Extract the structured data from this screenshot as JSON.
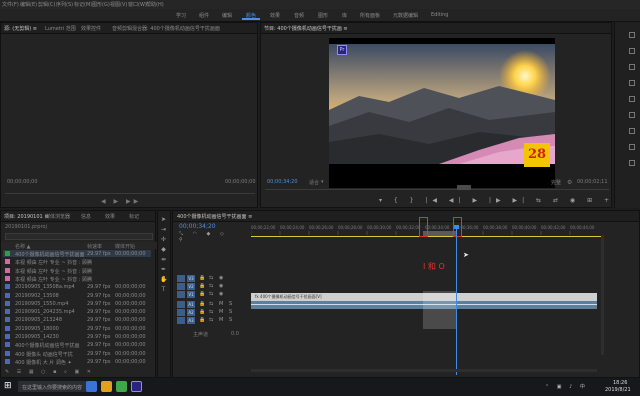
{
  "menu": [
    "文件(F)",
    "编辑(E)",
    "剪辑(C)",
    "序列(S)",
    "标记(M)",
    "图形(G)",
    "视图(V)",
    "窗口(W)",
    "帮助(H)"
  ],
  "workspaces": [
    "学习",
    "组件",
    "编辑",
    "颜色",
    "效果",
    "音频",
    "图形",
    "库",
    "所有面板",
    "元数据编辑",
    "Editing"
  ],
  "active_workspace": "颜色",
  "source_panel": {
    "tabs": [
      "源: (无剪辑) ≡",
      "Lumetri 范围",
      "效果控件",
      "音频剪辑混合器: 400个摄像机动画信号干扰画面"
    ],
    "tc_left": "00;00;00;00",
    "tc_right": "00;00;00;00"
  },
  "program_panel": {
    "title": "节目: 400个摄像机动画信号干扰画 ≡",
    "playhead_tc": "00;00;34;20",
    "fit_label": "适合",
    "quality_label": "完整",
    "duration_tc": "00;00;02;11",
    "pr_badge": "Pr",
    "overlay_number": "28"
  },
  "project_panel": {
    "tabs": [
      "项目: 20190101 ≡",
      "媒体浏览器",
      "信息",
      "效果",
      "标记"
    ],
    "project_file": "20190101.prproj",
    "columns": [
      "名称 ▲",
      "帧速率",
      "媒体开始"
    ],
    "rows": [
      {
        "name": "400个摄像机动画信号干扰画面",
        "fps": "29.97 fps",
        "start": "00;00;00;00",
        "color": "#2ea043"
      },
      {
        "name": "本视 频由 左叶 专业 ~ 抖音 : 顾腾",
        "fps": "",
        "start": "",
        "color": "#d16aa8"
      },
      {
        "name": "本视 频由 左叶 专业 ~ 抖音 : 顾腾",
        "fps": "",
        "start": "",
        "color": "#d16aa8"
      },
      {
        "name": "本视 频由 左叶 专业 ~ 抖音 : 顾腾",
        "fps": "",
        "start": "",
        "color": "#d16aa8"
      },
      {
        "name": "20190905_13508a.mp4",
        "fps": "29.97 fps",
        "start": "00;00;00;00",
        "color": "#4b69b8"
      },
      {
        "name": "20190902_13508",
        "fps": "29.97 fps",
        "start": "00;00;00;00",
        "color": "#4b69b8"
      },
      {
        "name": "20190905_1550.mp4",
        "fps": "29.97 fps",
        "start": "00;00;00;00",
        "color": "#4b69b8"
      },
      {
        "name": "20190901_204235.mp4",
        "fps": "29.97 fps",
        "start": "00;00;00;00",
        "color": "#4b69b8"
      },
      {
        "name": "20190905_213248",
        "fps": "29.97 fps",
        "start": "00;00;00;00",
        "color": "#4b69b8"
      },
      {
        "name": "20190905_18000",
        "fps": "29.97 fps",
        "start": "00;00;00;00",
        "color": "#4b69b8"
      },
      {
        "name": "20190905_14230",
        "fps": "29.97 fps",
        "start": "00;00;00;00",
        "color": "#4b69b8"
      },
      {
        "name": "400个摄像机动画信号干扰画",
        "fps": "29.97 fps",
        "start": "00;00;00;00",
        "color": "#4b69b8"
      },
      {
        "name": "400 摄像头 动画信号干扰",
        "fps": "29.97 fps",
        "start": "00;00;00;00",
        "color": "#4b69b8"
      },
      {
        "name": "400 摄像机 大 片 调色 ✦",
        "fps": "29.97 fps",
        "start": "00;00;00;00",
        "color": "#4b69b8"
      }
    ]
  },
  "timeline": {
    "title": "400个摄像机动画信号干扰画面 ≡",
    "playhead_tc": "00;00;34;20",
    "ticks": [
      "00;00;22;00",
      "00;00;24;00",
      "00;00;26;00",
      "00;00;28;00",
      "00;00;30;00",
      "00;00;32;00",
      "00;00;34;00",
      "00;00;36;00",
      "00;00;38;00",
      "00;00;40;00",
      "00;00;42;00",
      "00;00;44;00"
    ],
    "annotation": "I 和 O",
    "clip_label": "fx 400个摄像机动画信号干扰画面[V]",
    "tracks": [
      "V3",
      "V2",
      "V1",
      "A1",
      "A2",
      "A3"
    ],
    "master_label": "主声道",
    "master_value": "0.0"
  },
  "taskbar": {
    "search_placeholder": "在这里输入你要搜索的内容",
    "time": "18:26",
    "date": "2019/8/21"
  },
  "colors": {
    "accent": "#4d8fe0",
    "annotation_red": "#e0342e",
    "playhead": "#3a8ee6"
  }
}
